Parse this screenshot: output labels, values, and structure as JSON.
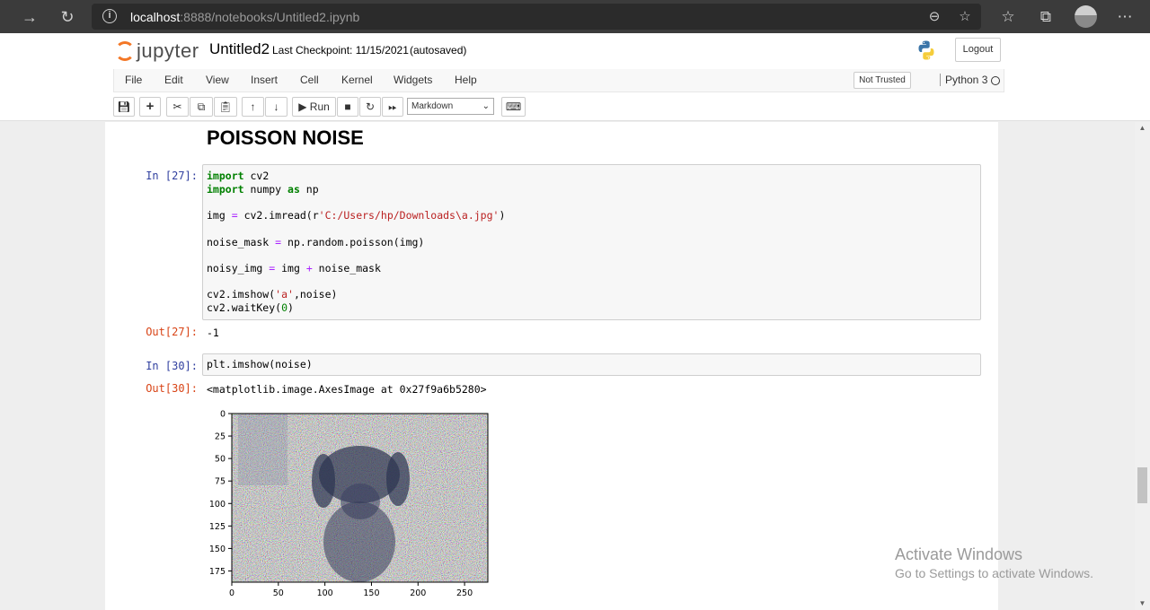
{
  "browser": {
    "url_host": "localhost",
    "url_path": ":8888/notebooks/Untitled2.ipynb"
  },
  "header": {
    "logo_text": "jupyter",
    "notebook_name": "Untitled2",
    "checkpoint": "Last Checkpoint: 11/15/2021",
    "autosave": "(autosaved)",
    "logout_label": "Logout"
  },
  "menubar": {
    "items": [
      "File",
      "Edit",
      "View",
      "Insert",
      "Cell",
      "Kernel",
      "Widgets",
      "Help"
    ],
    "trust_label": "Not Trusted",
    "kernel_name": "Python 3"
  },
  "toolbar": {
    "run_label": "Run",
    "cell_type": "Markdown"
  },
  "notebook": {
    "heading": "POISSON NOISE",
    "cells": [
      {
        "in_prompt": "In [27]:",
        "out_prompt": "Out[27]:",
        "output": "-1"
      },
      {
        "in_prompt": "In [30]:",
        "code": "plt.imshow(noise)",
        "out_prompt": "Out[30]:",
        "output": "<matplotlib.image.AxesImage at 0x27f9a6b5280>"
      }
    ],
    "plot": {
      "y_ticks": [
        "0",
        "25",
        "50",
        "75",
        "100",
        "125",
        "150",
        "175"
      ],
      "x_ticks": [
        "0",
        "50",
        "100",
        "150",
        "200",
        "250"
      ]
    }
  },
  "watermark": {
    "line1": "Activate Windows",
    "line2": "Go to Settings to activate Windows."
  },
  "colors": {
    "in_prompt": "#303f9f",
    "out_prompt": "#d84315",
    "browser_bar": "#3b3b3b"
  }
}
